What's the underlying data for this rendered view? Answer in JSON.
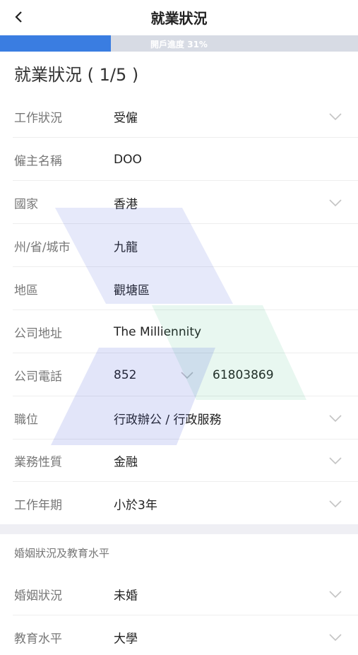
{
  "header": {
    "title": "就業狀況",
    "back_icon": "chevron-left-icon"
  },
  "progress": {
    "text": "開戶進度 31%",
    "percent": 31,
    "fill_color": "#3a7de1",
    "track_color": "#d7dbe4"
  },
  "section": {
    "title": "就業狀況 ( 1/5 )"
  },
  "employment_fields": [
    {
      "label": "工作狀況",
      "value": "受僱",
      "dropdown": true
    },
    {
      "label": "僱主名稱",
      "value": "DOO",
      "dropdown": false
    },
    {
      "label": "國家",
      "value": "香港",
      "dropdown": true
    },
    {
      "label": "州/省/城市",
      "value": "九龍",
      "dropdown": false
    },
    {
      "label": "地區",
      "value": "觀塘區",
      "dropdown": false
    },
    {
      "label": "公司地址",
      "value": "The Milliennity",
      "dropdown": false
    },
    {
      "label": "公司電話",
      "value": "852",
      "phone_number": "61803869",
      "dropdown": true
    },
    {
      "label": "職位",
      "value": "行政辦公 / 行政服務",
      "dropdown": true
    },
    {
      "label": "業務性質",
      "value": "金融",
      "dropdown": true
    },
    {
      "label": "工作年期",
      "value": "小於3年",
      "dropdown": true
    }
  ],
  "marital_section": {
    "title": "婚姻狀況及教育水平",
    "fields": [
      {
        "label": "婚姻狀況",
        "value": "未婚",
        "dropdown": true
      },
      {
        "label": "教育水平",
        "value": "大學",
        "dropdown": true
      }
    ]
  }
}
